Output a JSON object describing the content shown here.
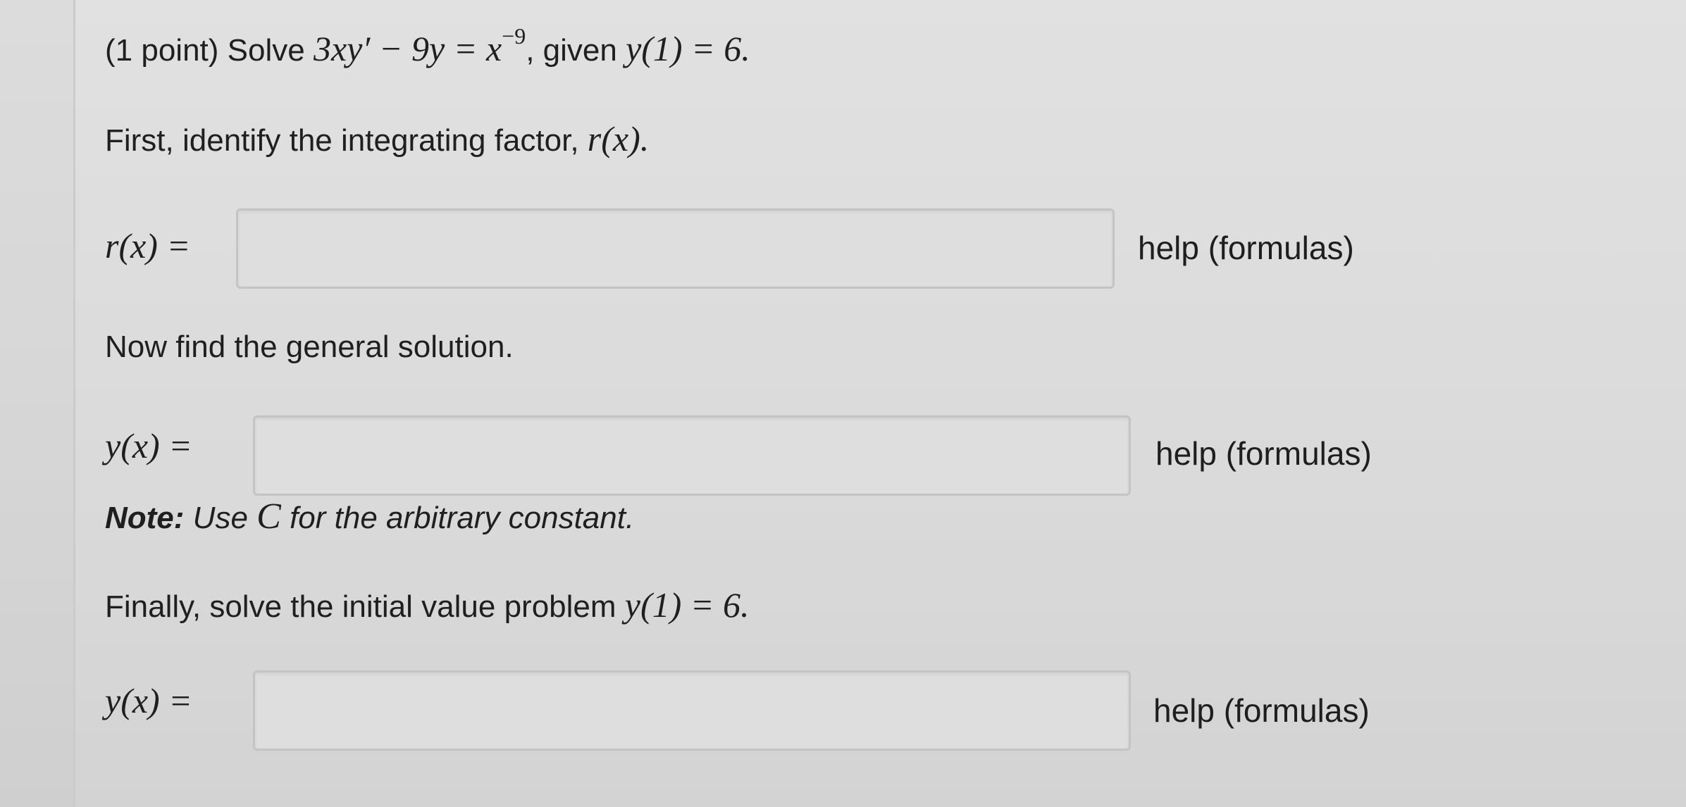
{
  "problem": {
    "points": "(1 point)",
    "solve_word": "Solve",
    "equation": "3xy′ − 9y = x",
    "exponent": "−9",
    "given": ", given",
    "initial_condition": "y(1) = 6."
  },
  "step1": {
    "prompt": "First, identify the integrating factor,",
    "prompt_var": "r(x).",
    "lhs": "r(x) =",
    "help": "help (formulas)"
  },
  "step2": {
    "prompt": "Now find the general solution.",
    "lhs": "y(x) =",
    "help": "help (formulas)",
    "note_bold": "Note:",
    "note_text": "Use",
    "note_var": "C",
    "note_rest": "for the arbitrary constant."
  },
  "step3": {
    "prompt": "Finally, solve the initial value problem",
    "prompt_var": "y(1) = 6.",
    "lhs": "y(x) =",
    "help": "help (formulas)"
  }
}
